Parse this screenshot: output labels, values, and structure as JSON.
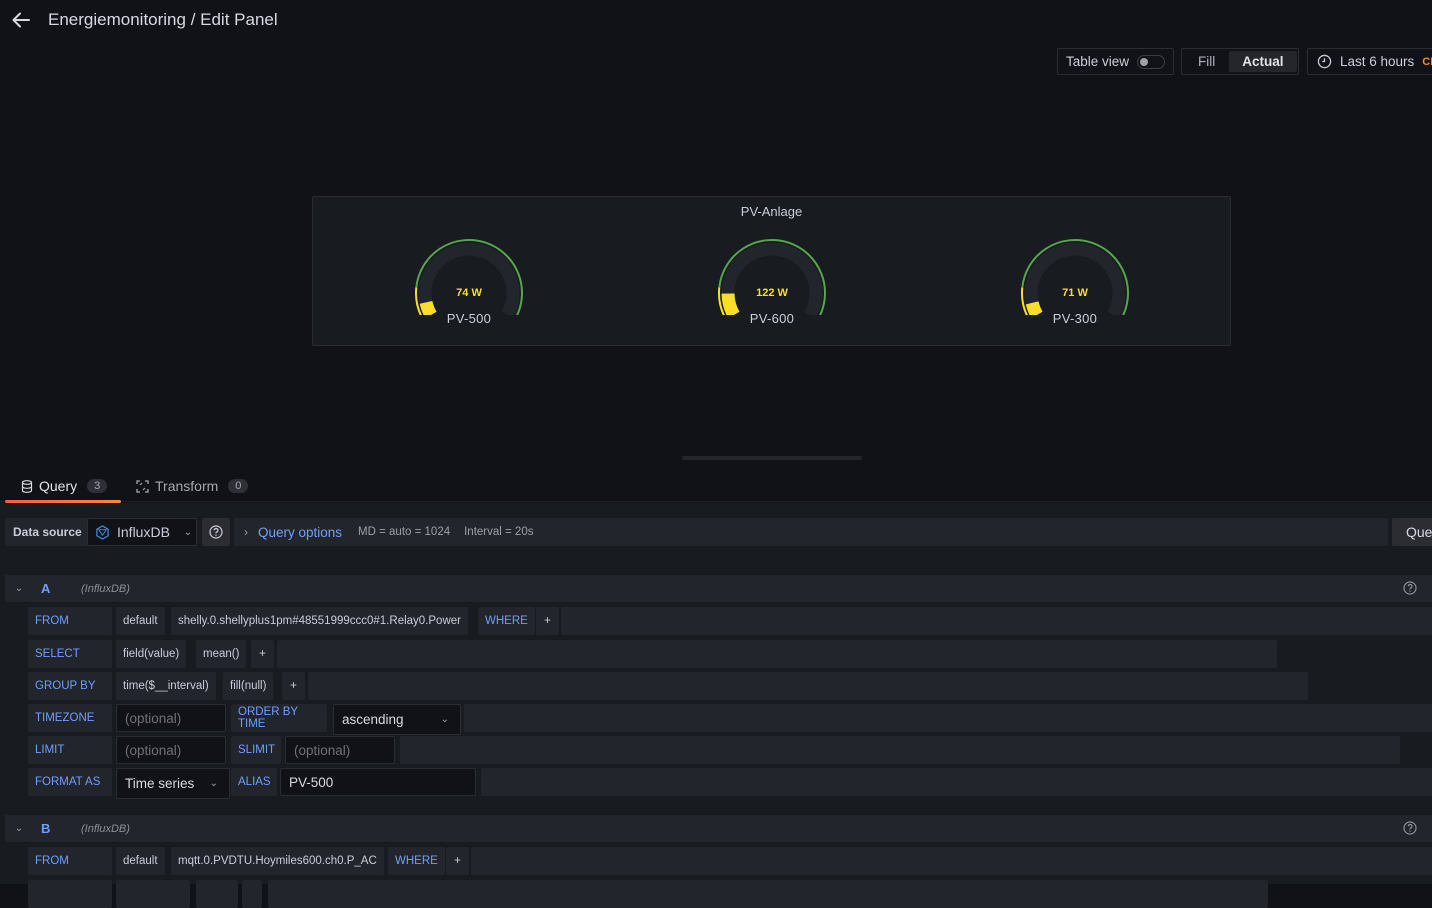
{
  "header": {
    "title": "Energiemonitoring / Edit Panel"
  },
  "toolbar": {
    "table_view_label": "Table view",
    "table_view_on": false,
    "fill_label": "Fill",
    "actual_label": "Actual",
    "active_mode": "Actual",
    "time_range": "Last 6 hours",
    "timezone": "CE"
  },
  "panel": {
    "title": "PV-Anlage",
    "colors": {
      "value": "#fade2a",
      "threshold_low": "#fade2a",
      "threshold_high": "#56a64b",
      "track": "#22252b"
    },
    "gauges": [
      {
        "name": "PV-500",
        "value": 74,
        "unit": "W",
        "display": "74 W",
        "min": 0,
        "max": 1000,
        "threshold": 150
      },
      {
        "name": "PV-600",
        "value": 122,
        "unit": "W",
        "display": "122 W",
        "min": 0,
        "max": 1000,
        "threshold": 150
      },
      {
        "name": "PV-300",
        "value": 71,
        "unit": "W",
        "display": "71 W",
        "min": 0,
        "max": 1000,
        "threshold": 150
      }
    ]
  },
  "tabs": [
    {
      "label": "Query",
      "count": "3",
      "active": true
    },
    {
      "label": "Transform",
      "count": "0",
      "active": false
    }
  ],
  "datasource": {
    "label": "Data source",
    "selected": "InfluxDB",
    "query_options_label": "Query options",
    "md": "MD = auto = 1024",
    "interval": "Interval = 20s",
    "inspector_label": "Query inspector"
  },
  "queries": [
    {
      "ref": "A",
      "datasource": "(InfluxDB)",
      "from": {
        "label": "FROM",
        "policy": "default",
        "measurement": "shelly.0.shellyplus1pm#48551999ccc0#1.Relay0.Power",
        "where_label": "WHERE"
      },
      "select": {
        "label": "SELECT",
        "field": "field(value)",
        "agg": "mean()"
      },
      "group_by": {
        "label": "GROUP BY",
        "time": "time($__interval)",
        "fill": "fill(null)"
      },
      "timezone": {
        "label": "TIMEZONE",
        "placeholder": "(optional)"
      },
      "order_by_time": {
        "label": "ORDER BY TIME",
        "value": "ascending"
      },
      "limit": {
        "label": "LIMIT",
        "placeholder": "(optional)"
      },
      "slimit": {
        "label": "SLIMIT",
        "placeholder": "(optional)"
      },
      "format_as": {
        "label": "FORMAT AS",
        "value": "Time series"
      },
      "alias": {
        "label": "ALIAS",
        "value": "PV-500"
      }
    },
    {
      "ref": "B",
      "datasource": "(InfluxDB)",
      "from": {
        "label": "FROM",
        "policy": "default",
        "measurement": "mqtt.0.PVDTU.Hoymiles600.ch0.P_AC",
        "where_label": "WHERE"
      }
    }
  ],
  "plus": "+"
}
